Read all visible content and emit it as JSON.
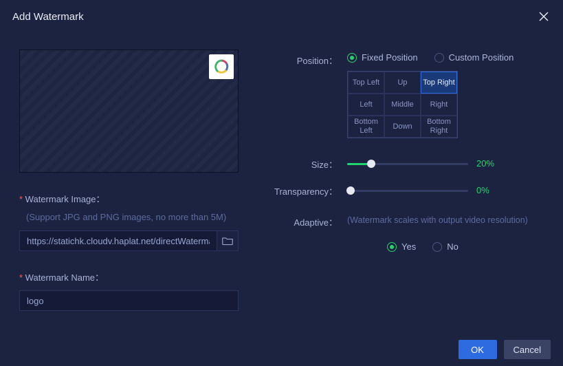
{
  "title": "Add Watermark",
  "left": {
    "imageLabel": "Watermark Image：",
    "imageHint": "(Support JPG and PNG images, no more than 5M)",
    "imageUrl": "https://statichk.cloudv.haplat.net/directWatermar",
    "nameLabel": "Watermark Name：",
    "nameValue": "logo"
  },
  "right": {
    "positionLabel": "Position：",
    "positionOptions": {
      "fixed": "Fixed Position",
      "custom": "Custom Position"
    },
    "positionMode": "fixed",
    "grid": [
      "Top Left",
      "Up",
      "Top Right",
      "Left",
      "Middle",
      "Right",
      "Bottom Left",
      "Down",
      "Bottom Right"
    ],
    "gridSelected": 2,
    "sizeLabel": "Size：",
    "sizeValue": 20,
    "sizeDisplay": "20%",
    "transparencyLabel": "Transparency：",
    "transparencyValue": 0,
    "transparencyDisplay": "0%",
    "adaptiveLabel": "Adaptive：",
    "adaptiveHint": "(Watermark scales with output video resolution)",
    "adaptiveOptions": {
      "yes": "Yes",
      "no": "No"
    },
    "adaptiveValue": "yes"
  },
  "footer": {
    "ok": "OK",
    "cancel": "Cancel"
  }
}
